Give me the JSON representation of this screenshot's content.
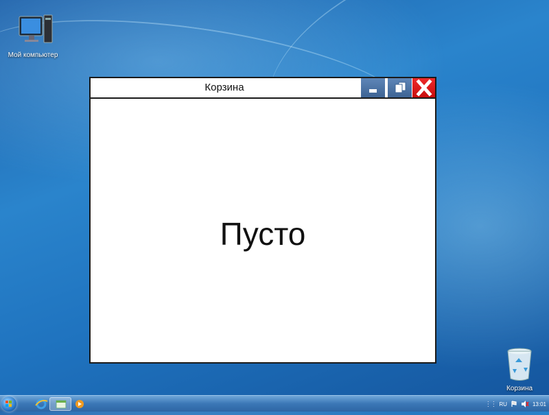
{
  "desktop": {
    "icons": [
      {
        "id": "my-computer",
        "label": "Мой компьютер"
      },
      {
        "id": "recycle-bin",
        "label": "Корзина"
      }
    ]
  },
  "window": {
    "title": "Корзина",
    "empty_message": "Пусто",
    "buttons": {
      "minimize": "minimize-icon",
      "restore": "restore-icon",
      "close": "close-icon"
    }
  },
  "taskbar": {
    "items": [
      "internet-explorer-icon",
      "explorer-window-icon",
      "media-player-icon"
    ],
    "tray": {
      "language": "RU",
      "clock": "13:01"
    }
  },
  "colors": {
    "close_button": "#d81414",
    "title_buttons": "#4a72a6",
    "desktop": "#2a84cc"
  }
}
